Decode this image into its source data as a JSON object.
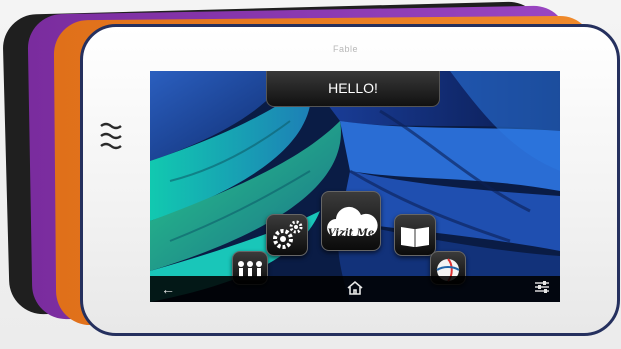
{
  "brand": "Fable",
  "screen": {
    "banner": "HELLO!",
    "apps": {
      "center_label": "Vizit Me"
    }
  },
  "icons": [
    "speaker-grille-icon",
    "back-arrow-icon",
    "home-icon",
    "settings-sliders-icon",
    "gears-icon",
    "cloud-icon",
    "book-icon",
    "kids-icon",
    "ball-icon"
  ],
  "colors": {
    "device_colors": [
      "#1f1f1f",
      "#8a3ab1",
      "#e8791f",
      "#ffffff"
    ],
    "device_border": "#25305e"
  }
}
